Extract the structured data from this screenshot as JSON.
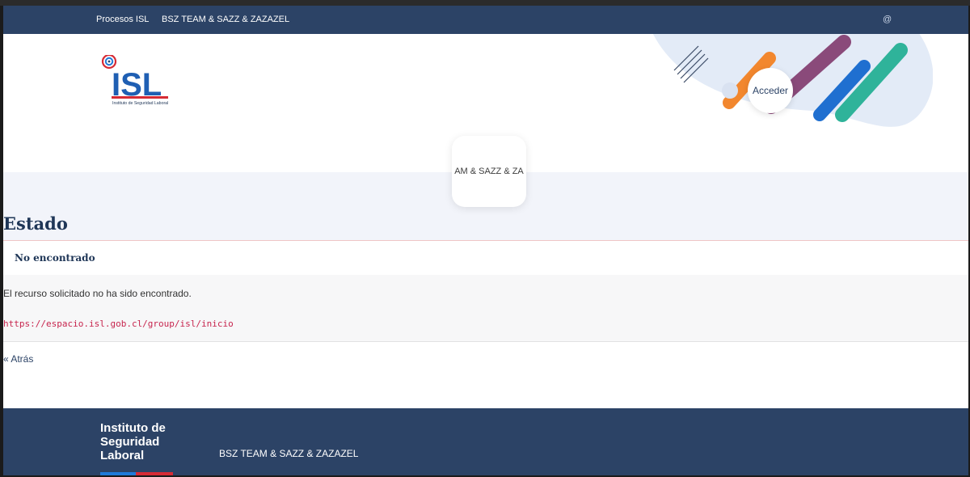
{
  "topbar": {
    "nav": [
      "Procesos ISL",
      "BSZ TEAM & SAZZ & ZAZAZEL"
    ],
    "at_symbol": "@"
  },
  "header": {
    "logo_text": "ISL",
    "logo_subtitle": "Instituto de Seguridad Laboral",
    "login_label": "Acceder",
    "site_card_text": "AM & SAZZ & ZA"
  },
  "main": {
    "title": "Estado",
    "status_label": "No encontrado",
    "message": "El recurso solicitado no ha sido encontrado.",
    "url": "https://espacio.isl.gob.cl/group/isl/inicio",
    "back_link": "« Atrás"
  },
  "footer": {
    "brand_lines": [
      "Instituto de",
      "Seguridad",
      "Laboral"
    ],
    "team": "BSZ TEAM & SAZZ & ZAZAZEL"
  },
  "colors": {
    "navy": "#2c4366",
    "link_code": "#c7254e"
  }
}
